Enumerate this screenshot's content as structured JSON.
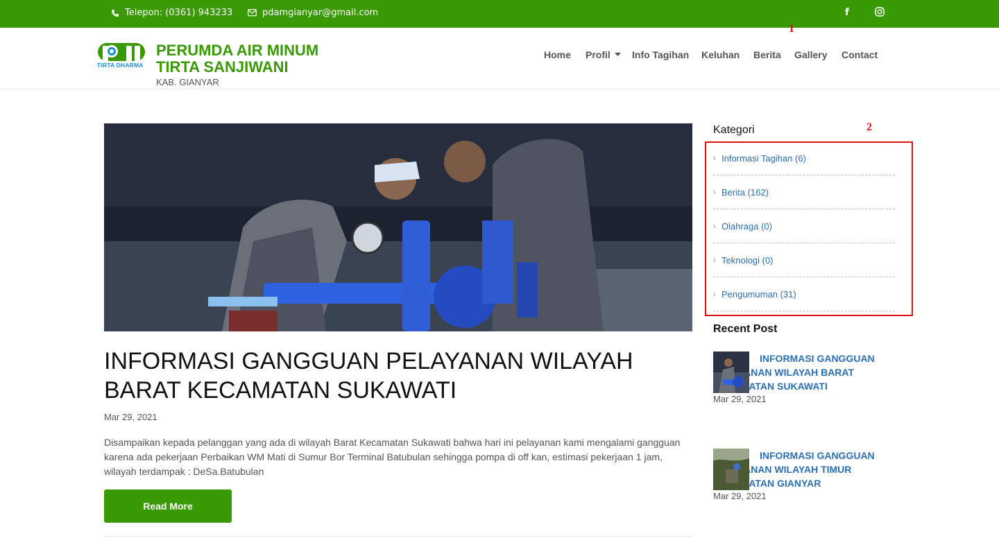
{
  "topbar": {
    "phone": "Telepon: (0361) 943233",
    "email": "pdamgianyar@gmail.com",
    "facebook_label": "f",
    "phone_icon": "phone-icon",
    "email_icon": "envelope-icon",
    "instagram_icon": "instagram-icon"
  },
  "header": {
    "logo_text": "TIRTA DHARMA",
    "title_line1": "PERUMDA AIR MINUM",
    "title_line2": "TIRTA SANJIWANI",
    "subtitle": "KAB. GIANYAR"
  },
  "nav": {
    "items": [
      {
        "label": "Home"
      },
      {
        "label": "Profil"
      },
      {
        "label": "Info Tagihan"
      },
      {
        "label": "Keluhan"
      },
      {
        "label": "Berita"
      },
      {
        "label": "Gallery"
      },
      {
        "label": "Contact"
      }
    ]
  },
  "annotations": [
    "1",
    "2"
  ],
  "post": {
    "title": "INFORMASI GANGGUAN PELAYANAN WILAYAH BARAT KECAMATAN SUKAWATI",
    "date": "Mar 29, 2021",
    "excerpt": "Disampaikan kepada pelanggan yang ada di wilayah Barat Kecamatan Sukawati bahwa hari ini pelayanan kami mengalami gangguan karena ada pekerjaan Perbaikan WM Mati di Sumur Bor  Terminal Batubulan sehingga  pompa di off kan, estimasi pekerjaan 1 jam, wilayah terdampak : DeSa.Batubulan",
    "read_more": "Read More"
  },
  "sidebar": {
    "kategori_heading": "Kategori",
    "categories": [
      {
        "label": "Informasi Tagihan (6)"
      },
      {
        "label": "Berita (162)"
      },
      {
        "label": "Olahraga (0)"
      },
      {
        "label": "Teknologi (0)"
      },
      {
        "label": "Pengumuman (31)"
      }
    ],
    "recent_heading": "Recent Post",
    "recent_posts": [
      {
        "title": "INFORMASI GANGGUAN PELAYANAN WILAYAH BARAT KECAMATAN SUKAWATI",
        "date": "Mar 29, 2021"
      },
      {
        "title": "INFORMASI GANGGUAN PELAYANAN WILAYAH TIMUR KECAMATAN GIANYAR",
        "date": "Mar 29, 2021"
      }
    ]
  },
  "colors": {
    "brand_green": "#3a9a06",
    "link_blue": "#2b6fb0",
    "annotation_red": "#e01010"
  }
}
